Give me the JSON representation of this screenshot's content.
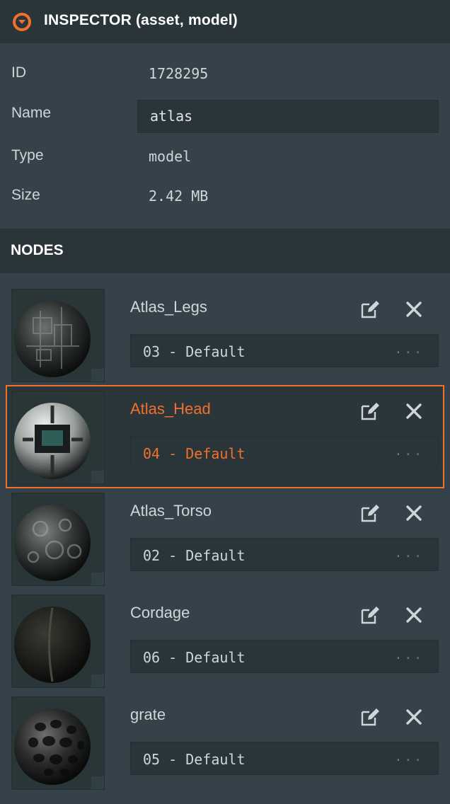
{
  "header": {
    "title": "INSPECTOR (asset, model)",
    "icon": "collapse-arrow-icon",
    "accent": "#f2702b"
  },
  "props": {
    "id_label": "ID",
    "id_value": "1728295",
    "name_label": "Name",
    "name_value": "atlas",
    "type_label": "Type",
    "type_value": "model",
    "size_label": "Size",
    "size_value": "2.42 MB"
  },
  "nodes_section": {
    "title": "NODES"
  },
  "nodes": [
    {
      "name": "Atlas_Legs",
      "material": "03 - Default",
      "more": "...",
      "selected": false
    },
    {
      "name": "Atlas_Head",
      "material": "04 - Default",
      "more": "...",
      "selected": true
    },
    {
      "name": "Atlas_Torso",
      "material": "02 - Default",
      "more": "...",
      "selected": false
    },
    {
      "name": "Cordage",
      "material": "06 - Default",
      "more": "...",
      "selected": false
    },
    {
      "name": "grate",
      "material": "05 - Default",
      "more": "...",
      "selected": false
    }
  ]
}
